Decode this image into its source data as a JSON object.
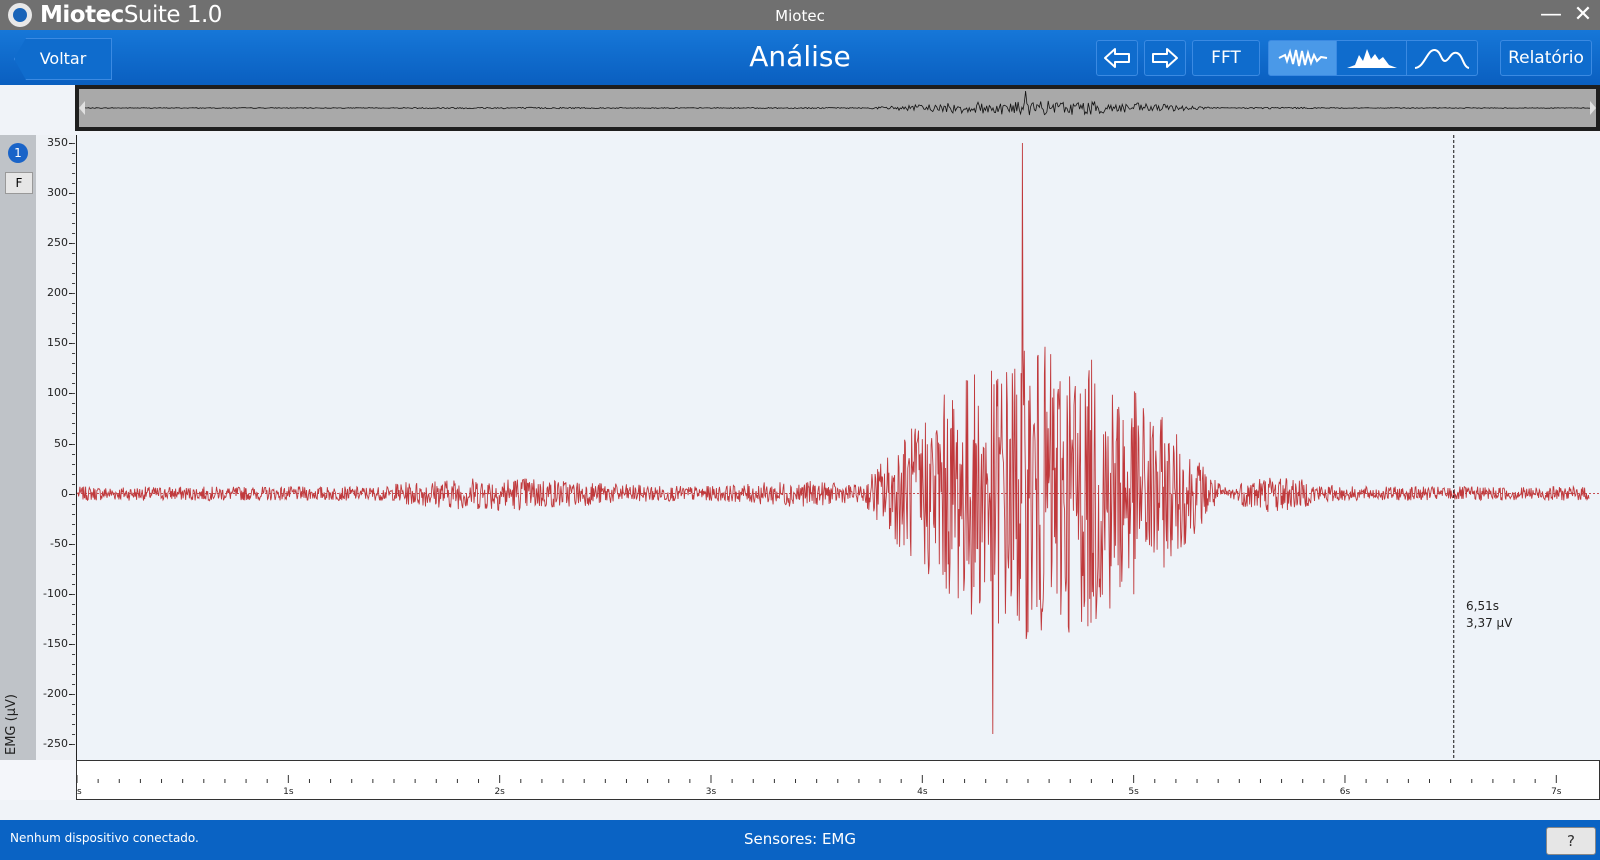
{
  "window": {
    "app_name_bold": "Miotec",
    "app_name_rest": "Suite 1.0",
    "title": "Miotec",
    "minimize_glyph": "—",
    "close_glyph": "✕"
  },
  "toolbar": {
    "back_label": "Voltar",
    "page_title": "Análise",
    "prev_icon": "arrow-left-icon",
    "next_icon": "arrow-right-icon",
    "fft_label": "FFT",
    "view_modes": [
      "raw-signal-icon",
      "envelope-icon",
      "smoothed-curve-icon"
    ],
    "report_label": "Relatório"
  },
  "channel": {
    "number": "1",
    "filter_label": "F",
    "ylabel": "EMG (µV)"
  },
  "chart_data": {
    "type": "line",
    "ylabel": "EMG (µV)",
    "ylim": [
      -250,
      350
    ],
    "yticks": [
      350,
      300,
      250,
      200,
      150,
      100,
      50,
      0,
      -50,
      -100,
      -150,
      -200,
      -250
    ],
    "xlim": [
      0,
      7.2
    ],
    "xticks": [
      "s",
      "1s",
      "2s",
      "3s",
      "4s",
      "5s",
      "6s",
      "7s"
    ],
    "series": [
      {
        "color": "#c0393c",
        "peak": 350,
        "trough": -240,
        "burst_start_s": 3.7,
        "burst_end_s": 5.5
      }
    ],
    "cursor": {
      "time": "6,51s",
      "value": "3,37 µV"
    }
  },
  "status": {
    "left": "Nenhum dispositivo conectado.",
    "center": "Sensores: EMG",
    "help": "?"
  },
  "colors": {
    "toolbar": "#0a5fc0",
    "signal": "#c0393c"
  }
}
